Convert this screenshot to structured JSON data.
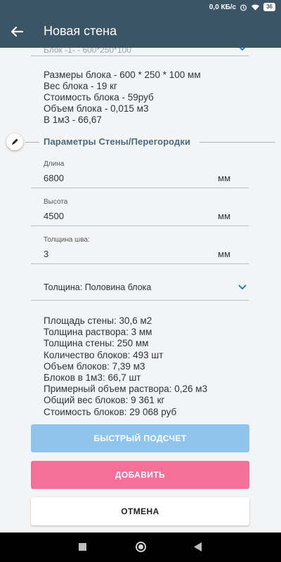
{
  "status_bar": {
    "speed": "0,0 КБ/с",
    "battery": "36",
    "icons": [
      "alarm-icon",
      "wifi-icon",
      "battery-icon"
    ]
  },
  "appbar": {
    "title": "Новая стена",
    "back_icon": "arrow-back-icon"
  },
  "block_selector": {
    "value": "Блок -1- - 600*250*100"
  },
  "block_info": [
    "Размеры блока - 600 * 250 * 100 мм",
    "Вес блока - 19 кг",
    "Стоимость блока - 59руб",
    "Объем блока - 0,015 м3",
    "В 1м3 - 66,67"
  ],
  "section": {
    "title": "Параметры Стены/Перегородки",
    "edit_icon": "pencil-icon"
  },
  "fields": {
    "length": {
      "label": "Длина",
      "value": "6800",
      "unit": "мм"
    },
    "height": {
      "label": "Высота",
      "value": "4500",
      "unit": "мм"
    },
    "seam": {
      "label": "Толщина шва:",
      "value": "3",
      "unit": "мм"
    }
  },
  "thickness_selector": {
    "label": "Толщина: Половина блока"
  },
  "results": [
    "Площадь стены: 30,6 м2",
    "Толщина раствора: 3 мм",
    "Толщина стены: 250 мм",
    "Количество блоков: 493 шт",
    "Объем блоков: 7,39 м3",
    "Блоков в 1м3: 66,7 шт",
    "Примерный объем раствора: 0,26 м3",
    "Общий вес блоков: 9 361 кг",
    "Стоимость блоков: 29 068 руб"
  ],
  "buttons": {
    "quick": "БЫСТРЫЙ ПОДСЧЕТ",
    "add": "ДОБАВИТЬ",
    "cancel": "ОТМЕНА"
  },
  "colors": {
    "appbar": "#3b5566",
    "quick_button": "#8fc4ee",
    "add_button": "#f4709b",
    "section_title": "#4a6a80",
    "accent_chevron": "#2b7fb8"
  }
}
